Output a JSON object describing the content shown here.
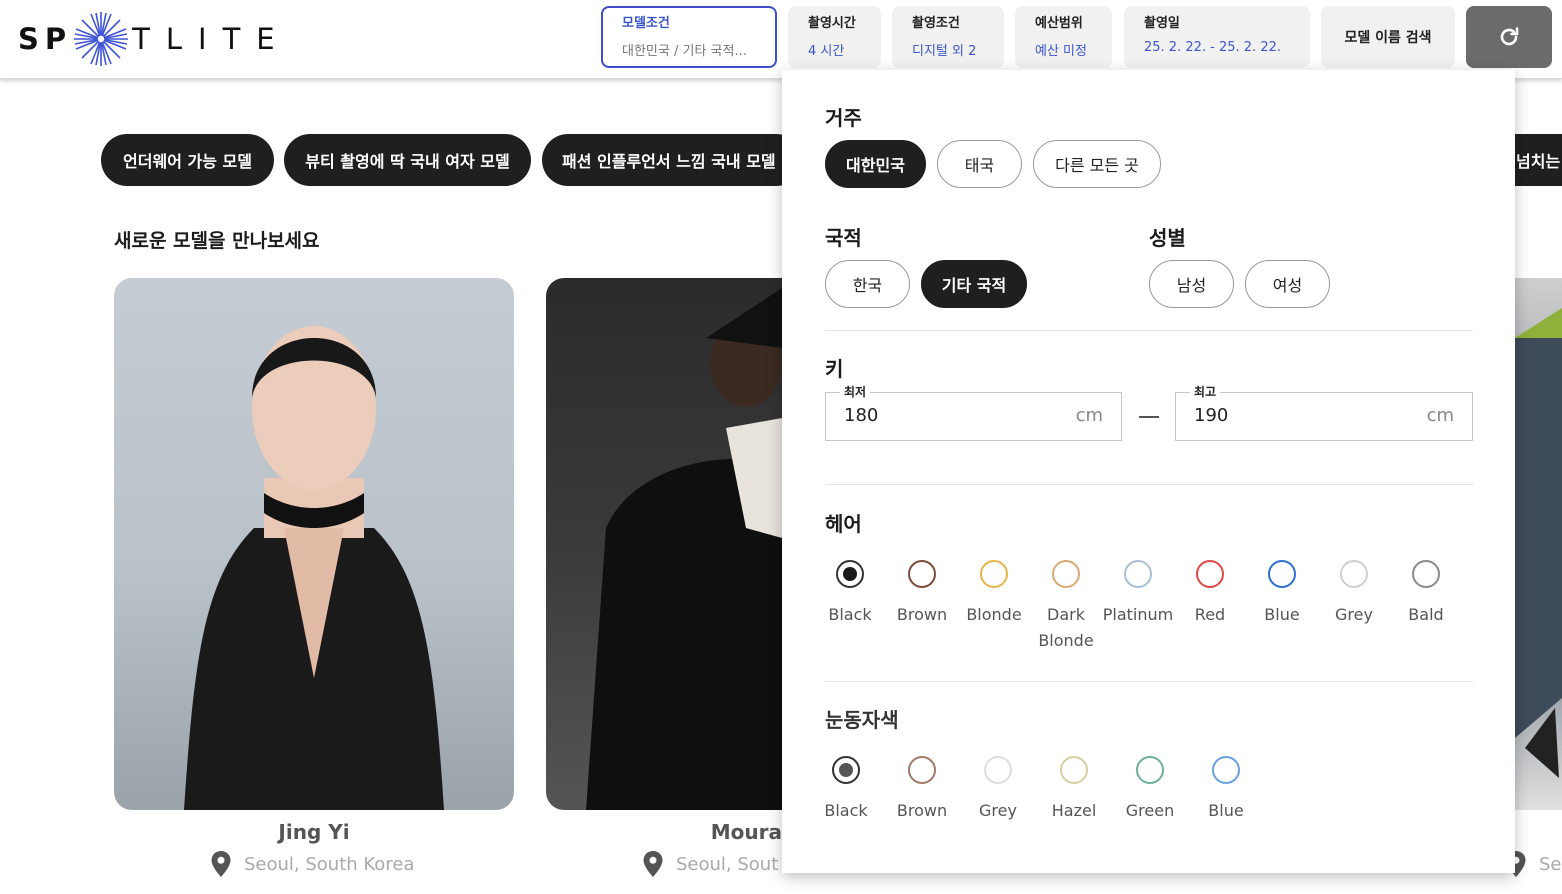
{
  "brand": {
    "logo_left": "SP",
    "logo_right": "TLITE"
  },
  "header": {
    "filters": [
      {
        "label": "모델조건",
        "value": "대한민국 / 기타 국적..."
      },
      {
        "label": "촬영시간",
        "value": "4 시간"
      },
      {
        "label": "촬영조건",
        "value": "디지털 외 2"
      },
      {
        "label": "예산범위",
        "value": "예산 미정"
      },
      {
        "label": "촬영일",
        "value": "25. 2. 22. - 25. 2. 22."
      }
    ],
    "name_search": "모델 이름 검색",
    "reset_icon": "refresh-icon"
  },
  "tags": [
    "언더웨어 가능 모델",
    "뷰티 촬영에 딱 국내 여자 모델",
    "패션 인플루언서 느낌 국내 모델",
    "넘치는"
  ],
  "section_title": "새로운 모델을 만나보세요",
  "models": [
    {
      "name": "Jing Yi",
      "location": "Seoul, South Korea"
    },
    {
      "name": "Moura",
      "location": "Seoul, Sout"
    },
    {
      "name": "",
      "location": "Se"
    }
  ],
  "panel": {
    "residence": {
      "label": "거주",
      "options": [
        "대한민국",
        "태국",
        "다른 모든 곳"
      ],
      "selected": "대한민국"
    },
    "nationality": {
      "label": "국적",
      "options": [
        "한국",
        "기타 국적"
      ],
      "selected": "기타 국적"
    },
    "gender": {
      "label": "성별",
      "options": [
        "남성",
        "여성"
      ]
    },
    "height": {
      "label": "키",
      "min_caption": "최저",
      "min_value": "180",
      "max_caption": "최고",
      "max_value": "190",
      "unit": "cm"
    },
    "hair": {
      "label": "헤어",
      "selected": "Black",
      "options": [
        {
          "name": "Black",
          "color": "#1a1a1a"
        },
        {
          "name": "Brown",
          "color": "#7a4a3a"
        },
        {
          "name": "Blonde",
          "color": "#e7b54a"
        },
        {
          "name": "Dark Blonde",
          "color": "#d9aa74"
        },
        {
          "name": "Platinum",
          "color": "#a9bfd6"
        },
        {
          "name": "Red",
          "color": "#e04848"
        },
        {
          "name": "Blue",
          "color": "#2f6fd0"
        },
        {
          "name": "Grey",
          "color": "#cfcfcf"
        },
        {
          "name": "Bald",
          "color": "#8a8a8a"
        }
      ]
    },
    "eye": {
      "label": "눈동자색",
      "selected": "Black",
      "options": [
        {
          "name": "Black",
          "color": "#555555"
        },
        {
          "name": "Brown",
          "color": "#a07a6a"
        },
        {
          "name": "Grey",
          "color": "#dddddd"
        },
        {
          "name": "Hazel",
          "color": "#d8cfa0"
        },
        {
          "name": "Green",
          "color": "#6fb09a"
        },
        {
          "name": "Blue",
          "color": "#6aa0e0"
        }
      ]
    }
  }
}
